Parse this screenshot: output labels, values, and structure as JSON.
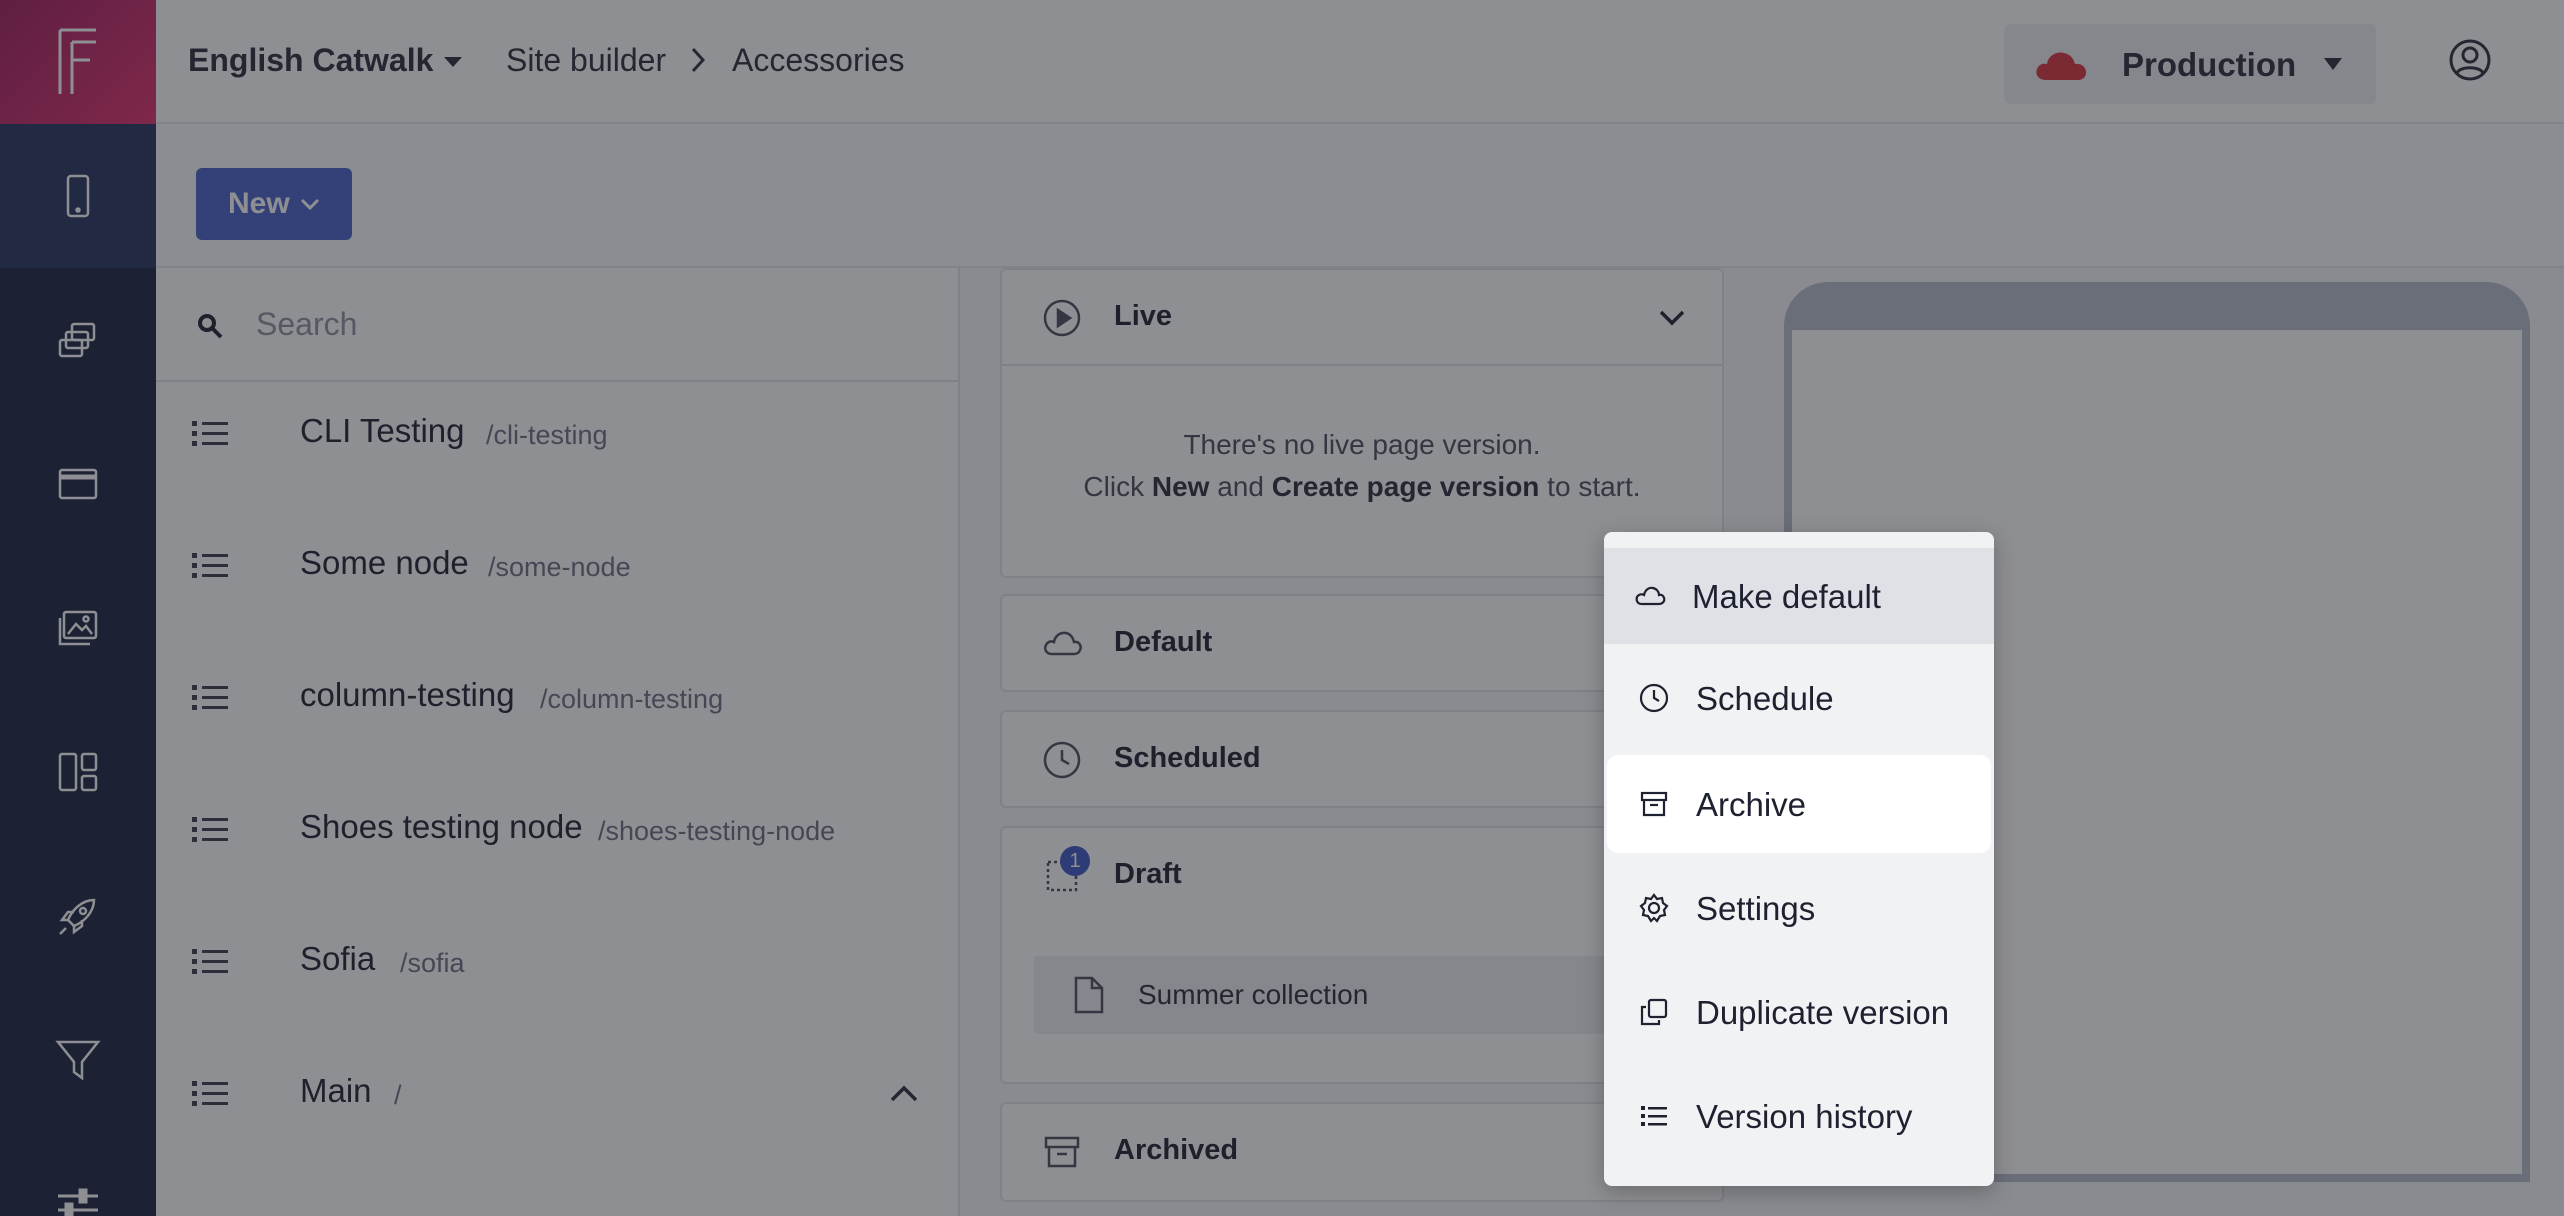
{
  "app": {
    "logo_letter": "F",
    "workspace": "English Catwalk",
    "breadcrumb": [
      "Site builder",
      "Accessories"
    ],
    "environment": "Production",
    "colors": {
      "rail": "#1a2340",
      "accent": "#4a63c8",
      "env_cloud": "#d9333f"
    }
  },
  "rail": {
    "items": [
      "mobile-icon",
      "pages-icon",
      "window-icon",
      "images-icon",
      "layout-icon",
      "rocket-icon",
      "filter-icon",
      "sliders-icon"
    ]
  },
  "toolbar": {
    "new_label": "New"
  },
  "search": {
    "placeholder": "Search",
    "value": ""
  },
  "nodes": [
    {
      "name": "CLI Testing",
      "path": "/cli-testing"
    },
    {
      "name": "Some node",
      "path": "/some-node"
    },
    {
      "name": "column-testing",
      "path": "/column-testing"
    },
    {
      "name": "Shoes testing node",
      "path": "/shoes-testing-node"
    },
    {
      "name": "Sofia",
      "path": "/sofia"
    },
    {
      "name": "Main",
      "path": "/"
    }
  ],
  "versions": {
    "live": {
      "title": "Live",
      "empty_line1": "There's no live page version.",
      "empty_prefix": "Click ",
      "empty_new": "New",
      "empty_and": " and ",
      "empty_create": "Create page version",
      "empty_suffix": " to start."
    },
    "default": {
      "title": "Default"
    },
    "scheduled": {
      "title": "Scheduled"
    },
    "draft": {
      "title": "Draft",
      "count": "1",
      "items": [
        "Summer collection"
      ]
    },
    "archived": {
      "title": "Archived"
    }
  },
  "context_menu": {
    "items": [
      "Make default",
      "Schedule",
      "Archive",
      "Settings",
      "Duplicate version",
      "Version history"
    ]
  }
}
